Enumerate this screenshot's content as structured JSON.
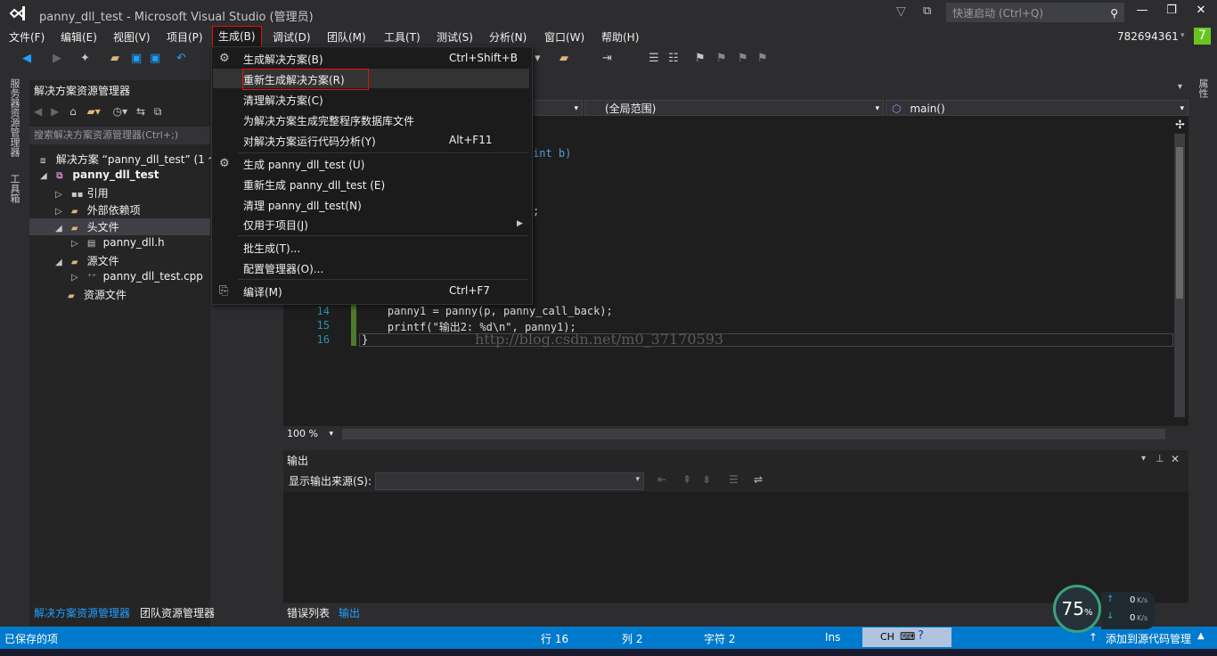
{
  "window": {
    "title": "panny_dll_test - Microsoft Visual Studio (管理员)",
    "quick_launch_placeholder": "快速启动 (Ctrl+Q)",
    "user": "782694361",
    "user_badge": "7"
  },
  "menubar": [
    "文件(F)",
    "编辑(E)",
    "视图(V)",
    "项目(P)",
    "生成(B)",
    "调试(D)",
    "团队(M)",
    "工具(T)",
    "测试(S)",
    "分析(N)",
    "窗口(W)",
    "帮助(H)"
  ],
  "left_vertical_tabs": [
    "服务器资源管理器",
    "工具箱"
  ],
  "right_vertical_tabs": [
    "属性"
  ],
  "solution_explorer": {
    "title": "解决方案资源管理器",
    "search_placeholder": "搜索解决方案资源管理器(Ctrl+;)",
    "tree": [
      {
        "label": "解决方案 “panny_dll_test” (1 个",
        "icon": "solution-icon"
      },
      {
        "label": "panny_dll_test",
        "icon": "project-icon",
        "bold": true
      },
      {
        "label": "引用",
        "icon": "references-icon"
      },
      {
        "label": "外部依赖项",
        "icon": "folder-icon"
      },
      {
        "label": "头文件",
        "icon": "folder-icon",
        "selected": true
      },
      {
        "label": "panny_dll.h",
        "icon": "header-file-icon"
      },
      {
        "label": "源文件",
        "icon": "folder-icon"
      },
      {
        "label": "panny_dll_test.cpp",
        "icon": "cpp-file-icon"
      },
      {
        "label": "资源文件",
        "icon": "folder-icon"
      }
    ],
    "bottom_tabs": [
      "解决方案资源管理器",
      "团队资源管理器"
    ]
  },
  "editor": {
    "scope_dropdown": "(全局范围)",
    "function_dropdown": "main()",
    "code_fragments": [
      "int b)",
      ";"
    ],
    "lines": [
      {
        "num": "14",
        "text": "    panny1 = panny(p, panny_call_back);"
      },
      {
        "num": "15",
        "text": "    printf(\"输出2: %d\\n\", panny1);"
      },
      {
        "num": "16",
        "text": "}"
      }
    ],
    "watermark": "http://blog.csdn.net/m0_37170593",
    "zoom": "100 %"
  },
  "build_menu": {
    "items": [
      {
        "label": "生成解决方案(B)",
        "shortcut": "Ctrl+Shift+B",
        "icon": "build-icon"
      },
      {
        "label": "重新生成解决方案(R)",
        "shortcut": "",
        "highlighted": true
      },
      {
        "label": "清理解决方案(C)",
        "shortcut": ""
      },
      {
        "label": "为解决方案生成完整程序数据库文件",
        "shortcut": ""
      },
      {
        "label": "对解决方案运行代码分析(Y)",
        "shortcut": "Alt+F11"
      },
      {
        "label": "生成 panny_dll_test (U)",
        "shortcut": "",
        "icon": "build-icon"
      },
      {
        "label": "重新生成 panny_dll_test (E)",
        "shortcut": ""
      },
      {
        "label": "清理 panny_dll_test(N)",
        "shortcut": ""
      },
      {
        "label": "仅用于项目(J)",
        "shortcut": "",
        "submenu": true
      },
      {
        "label": "批生成(T)...",
        "shortcut": ""
      },
      {
        "label": "配置管理器(O)...",
        "shortcut": ""
      },
      {
        "label": "编译(M)",
        "shortcut": "Ctrl+F7",
        "icon": "compile-icon"
      }
    ]
  },
  "output": {
    "title": "输出",
    "source_label": "显示输出来源(S):",
    "tabs": [
      "错误列表",
      "输出"
    ]
  },
  "status": {
    "message": "已保存的项",
    "line": "行 16",
    "col": "列 2",
    "char": "字符 2",
    "mode": "Ins",
    "ime": "CH",
    "source_control": "添加到源代码管理"
  },
  "net_monitor": {
    "percent": "75",
    "unit": "%",
    "up": "0",
    "down": "0",
    "rate_unit": "K/s"
  }
}
